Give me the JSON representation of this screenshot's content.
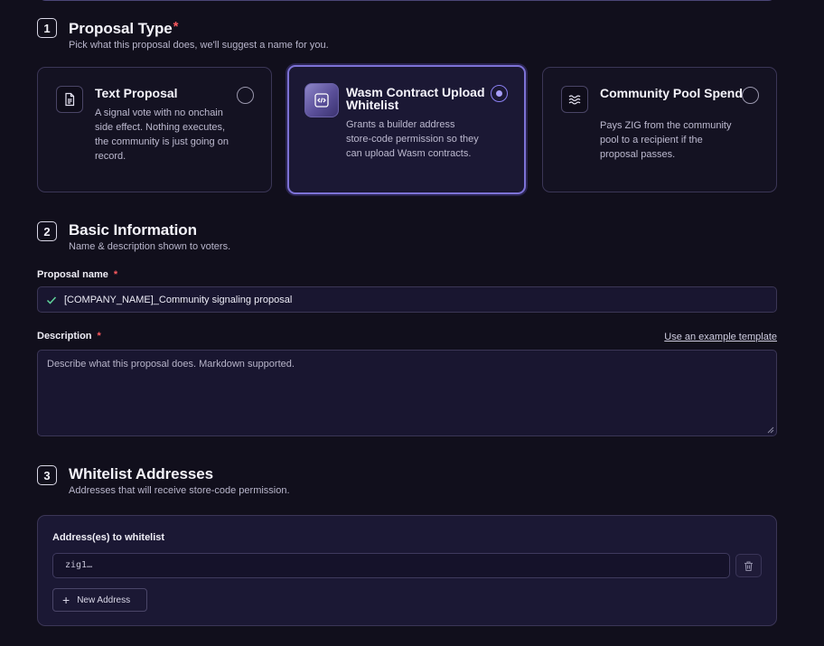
{
  "section1": {
    "number": "1",
    "title": "Proposal Type",
    "required_mark": "*",
    "subtitle": "Pick what this proposal does, we'll suggest a name for you."
  },
  "cards": [
    {
      "title": "Text Proposal",
      "description": "A signal vote with no onchain side effect. Nothing executes, the community is just going on record.",
      "icon": "document-icon",
      "selected": false
    },
    {
      "title": "Wasm Contract Upload Whitelist",
      "description": "Grants a builder address store-code permission so they can upload Wasm contracts.",
      "icon": "code-icon",
      "selected": true
    },
    {
      "title": "Community Pool Spend",
      "description": "Pays ZIG from the community pool to a recipient if the proposal passes.",
      "icon": "waves-icon",
      "selected": false
    }
  ],
  "section2": {
    "number": "2",
    "title": "Basic Information",
    "subtitle": "Name & description shown to voters."
  },
  "proposal_name": {
    "label": "Proposal name",
    "required_mark": "*",
    "value": "[COMPANY_NAME]_Community signaling proposal"
  },
  "description": {
    "label": "Description",
    "required_mark": "*",
    "template_link": "Use an example template",
    "placeholder": "Describe what this proposal does. Markdown supported."
  },
  "section3": {
    "number": "3",
    "title": "Whitelist Addresses",
    "subtitle": "Addresses that will receive store-code permission."
  },
  "whitelist": {
    "label": "Address(es) to whitelist",
    "placeholder": "zig1…",
    "add_button": "New Address"
  },
  "colors": {
    "background": "#110f1c",
    "accent": "#7d72d6",
    "required": "#ff5a5f"
  }
}
